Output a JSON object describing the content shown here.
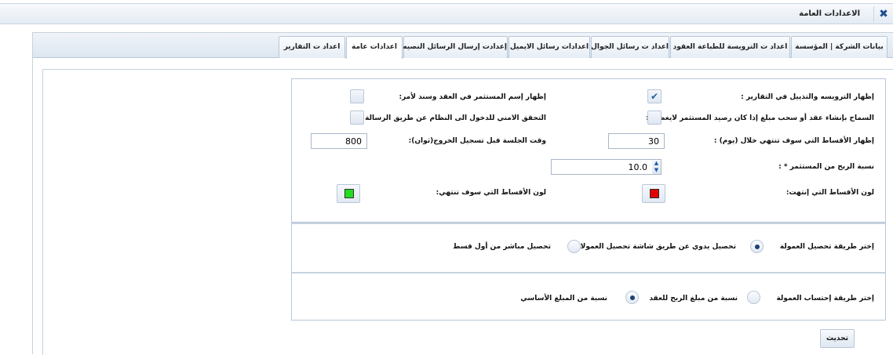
{
  "window": {
    "title": "الاعدادات العامة",
    "close_icon": "close-icon"
  },
  "tabs": [
    {
      "label": "بيانات الشركة | المؤسسة",
      "active": false
    },
    {
      "label": "اعداد ت الترويسة للطباعة العقود",
      "active": false
    },
    {
      "label": "اعداد ت رسائل الجوال",
      "active": false
    },
    {
      "label": "اعدادات رسائل الايميل",
      "active": false
    },
    {
      "label": "إعدادت إرسال الرسائل النصيه",
      "active": false
    },
    {
      "label": "اعدادات عامة",
      "active": true
    },
    {
      "label": "اعداد ت التقارير",
      "active": false
    }
  ],
  "settings": {
    "show_header_footer_label": "إظهار الترويسه والتذييل في التقارير :",
    "show_header_footer_checked": true,
    "show_investor_name_label": "إظهار إسم المستثمر في العقد وسند لأمر:",
    "show_investor_name_checked": false,
    "allow_contract_withdraw_label": "السماح بإنشاء عقد أو سحب مبلغ إذا كان رصيد المستثمر لايغطي :",
    "allow_contract_withdraw_checked": false,
    "security_check_label": "التحقق الامني للدخول الى النظام عن طريق الرسالة :",
    "security_check_checked": false,
    "expiring_installments_label": "إظهار الأقساط التي سوف تنتهي خلال (يوم) :",
    "expiring_installments_value": "30",
    "session_time_label": "وقت الجلسة قبل تسجيل الخروج(ثوان):",
    "session_time_value": "800",
    "profit_rate_label": "نسبة الربح من المستثمر * :",
    "profit_rate_value": "10.0",
    "expired_color_label": "لون الأقساط التي إنتهت:",
    "expired_color": "#e00000",
    "expiring_color_label": "لون الأقساط التي سوف تنتهي:",
    "expiring_color": "#22dd22"
  },
  "commission_collection": {
    "label": "إختر طريقة تحصيل العمولة",
    "option_manual": "تحصيل يدوي عن طريق شاشة تحصيل العمولات",
    "option_manual_selected": true,
    "option_direct": "تحصيل مباشر من أول قسط",
    "option_direct_selected": false
  },
  "commission_calculation": {
    "label": "إختر طريقة إحتساب العمولة",
    "option_contract_profit": "نسبة من مبلغ الربح للعقد",
    "option_contract_profit_selected": false,
    "option_base_amount": "نسبة من المبلغ الأساسي",
    "option_base_amount_selected": true
  },
  "actions": {
    "update_label": "تحديث"
  }
}
